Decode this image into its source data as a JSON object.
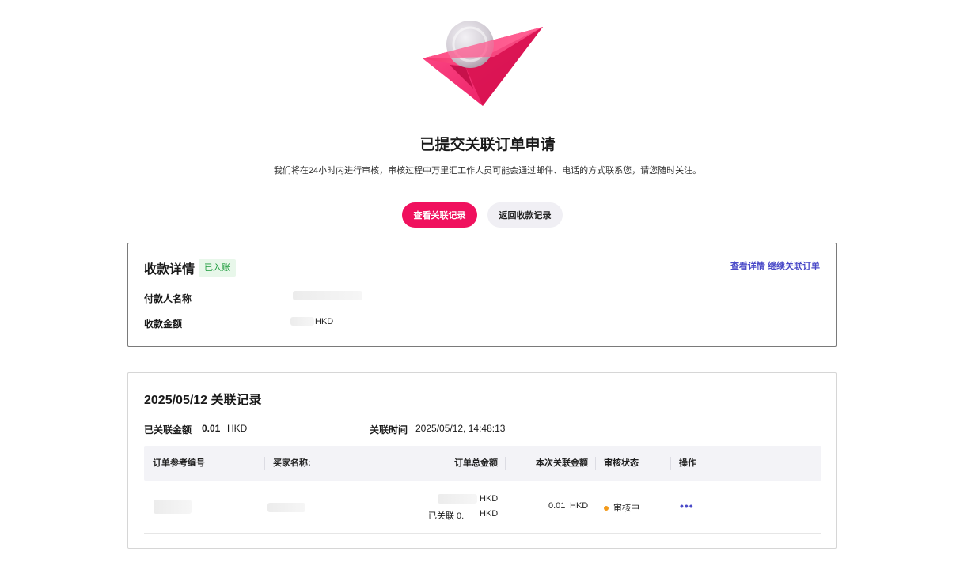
{
  "header": {
    "title": "已提交关联订单申请",
    "subtitle": "我们将在24小时内进行审核，审核过程中万里汇工作人员可能会通过邮件、电话的方式联系您，请您随时关注。",
    "primary_button": "查看关联记录",
    "secondary_button": "返回收款记录"
  },
  "receipt_details": {
    "title": "收款详情",
    "status_badge": "已入账",
    "link_view": "查看详情",
    "link_continue": "继续关联订单",
    "payer_label": "付款人名称",
    "amount_label": "收款金额",
    "amount_currency": "HKD"
  },
  "association_record": {
    "title": "2025/05/12 关联记录",
    "associated_amount_label": "已关联金额",
    "associated_amount_value": "0.01",
    "associated_amount_currency": "HKD",
    "time_label": "关联时间",
    "time_value": "2025/05/12, 14:48:13",
    "columns": [
      "订单参考编号",
      "买家名称:",
      "订单总金额",
      "本次关联金额",
      "审核状态",
      "操作"
    ],
    "row": {
      "total_currency": "HKD",
      "associated_prefix": "已关联 0.",
      "associated_currency": "HKD",
      "this_amount": "0.01",
      "this_currency": "HKD",
      "status": "审核中"
    }
  },
  "colors": {
    "primary": "#f0115e",
    "link": "#4a4ac8",
    "success": "#1a9a3a",
    "pending": "#f39a1a"
  },
  "icons": {
    "hero": "paper-plane-coin-illustration",
    "more": "more-dots-icon"
  }
}
